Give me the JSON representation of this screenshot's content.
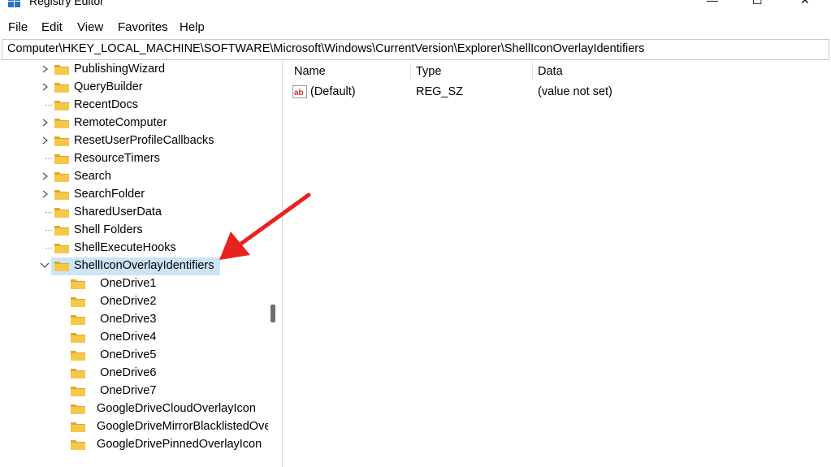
{
  "window": {
    "title": "Registry Editor",
    "minimize_glyph": "—",
    "maximize_glyph": "☐",
    "close_glyph": "✕"
  },
  "menu": [
    "File",
    "Edit",
    "View",
    "Favorites",
    "Help"
  ],
  "address": "Computer\\HKEY_LOCAL_MACHINE\\SOFTWARE\\Microsoft\\Windows\\CurrentVersion\\Explorer\\ShellIconOverlayIdentifiers",
  "tree": {
    "items": [
      {
        "label": "PublishingWizard",
        "expand": "collapsed"
      },
      {
        "label": "QueryBuilder",
        "expand": "collapsed"
      },
      {
        "label": "RecentDocs",
        "expand": "none"
      },
      {
        "label": "RemoteComputer",
        "expand": "collapsed"
      },
      {
        "label": "ResetUserProfileCallbacks",
        "expand": "collapsed"
      },
      {
        "label": "ResourceTimers",
        "expand": "none"
      },
      {
        "label": "Search",
        "expand": "collapsed"
      },
      {
        "label": "SearchFolder",
        "expand": "collapsed"
      },
      {
        "label": "SharedUserData",
        "expand": "none"
      },
      {
        "label": "Shell Folders",
        "expand": "none"
      },
      {
        "label": "ShellExecuteHooks",
        "expand": "none"
      },
      {
        "label": "ShellIconOverlayIdentifiers",
        "expand": "expanded",
        "selected": true
      }
    ],
    "children": [
      "   OneDrive1",
      "   OneDrive2",
      "   OneDrive3",
      "   OneDrive4",
      "   OneDrive5",
      "   OneDrive6",
      "   OneDrive7",
      "  GoogleDriveCloudOverlayIcon",
      "  GoogleDriveMirrorBlacklistedOverlayIcon",
      "  GoogleDrivePinnedOverlayIcon"
    ]
  },
  "list": {
    "columns": [
      "Name",
      "Type",
      "Data"
    ],
    "rows": [
      {
        "name": "(Default)",
        "type": "REG_SZ",
        "data": "(value not set)",
        "icon": "string-value-icon"
      }
    ]
  },
  "annotation": {
    "icon": "red-arrow-icon",
    "color": "#e8231f"
  },
  "colors": {
    "folder": "#f5c74a",
    "folder_dark": "#e0a92a",
    "selection": "#cce4f7"
  }
}
